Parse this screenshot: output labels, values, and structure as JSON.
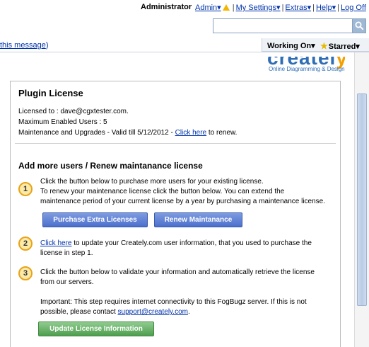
{
  "topnav": {
    "user": "Administrator",
    "admin_label": "Admin▾",
    "sep": "|",
    "my_settings": "My Settings▾",
    "extras": "Extras▾",
    "help": "Help▾",
    "logoff": "Log Off"
  },
  "search": {
    "placeholder": "",
    "value": ""
  },
  "notice": {
    "link_text": "this message",
    "close_paren": ")"
  },
  "tabs": {
    "working_on": "Working On▾",
    "starred": "Starred▾"
  },
  "logo": {
    "text_main": "createl",
    "text_y": "y",
    "tagline": "Online Diagramming & Design"
  },
  "panel": {
    "title": "Plugin License",
    "licensed_to": "Licensed to : dave@cgxtester.com.",
    "max_users": "Maximum Enabled Users : 5",
    "maintenance_prefix": "Maintenance and Upgrades - Valid till 5/12/2012 - ",
    "click_here": "Click here",
    "maintenance_suffix": " to renew.",
    "add_title": "Add more users / Renew maintanance license",
    "step1": {
      "num": "1",
      "line1": "Click the button below to purchase more users for your existing license.",
      "line2": "To renew your maintenance license click the button below. You can extend the",
      "line3": "maintenance period of your current license by a year by purchasing a maintenance license."
    },
    "purchase_button": "Purchase Extra Licenses",
    "renew_button": "Renew Maintanance",
    "step2": {
      "num": "2",
      "link": "Click here",
      "line1_rest": " to update your Creately.com user information, that you used to purchase the",
      "line2": "license in step 1."
    },
    "step3": {
      "num": "3",
      "line1": "Click the button below to validate your information and automatically retrieve the license",
      "line2": "from our servers.",
      "line3": "Important: This step requires internet connectivity to this FogBugz server. If this is not",
      "line4_prefix": "possible, please contact ",
      "email": "support@creately.com",
      "line4_suffix": "."
    },
    "update_button": "Update License Information"
  }
}
